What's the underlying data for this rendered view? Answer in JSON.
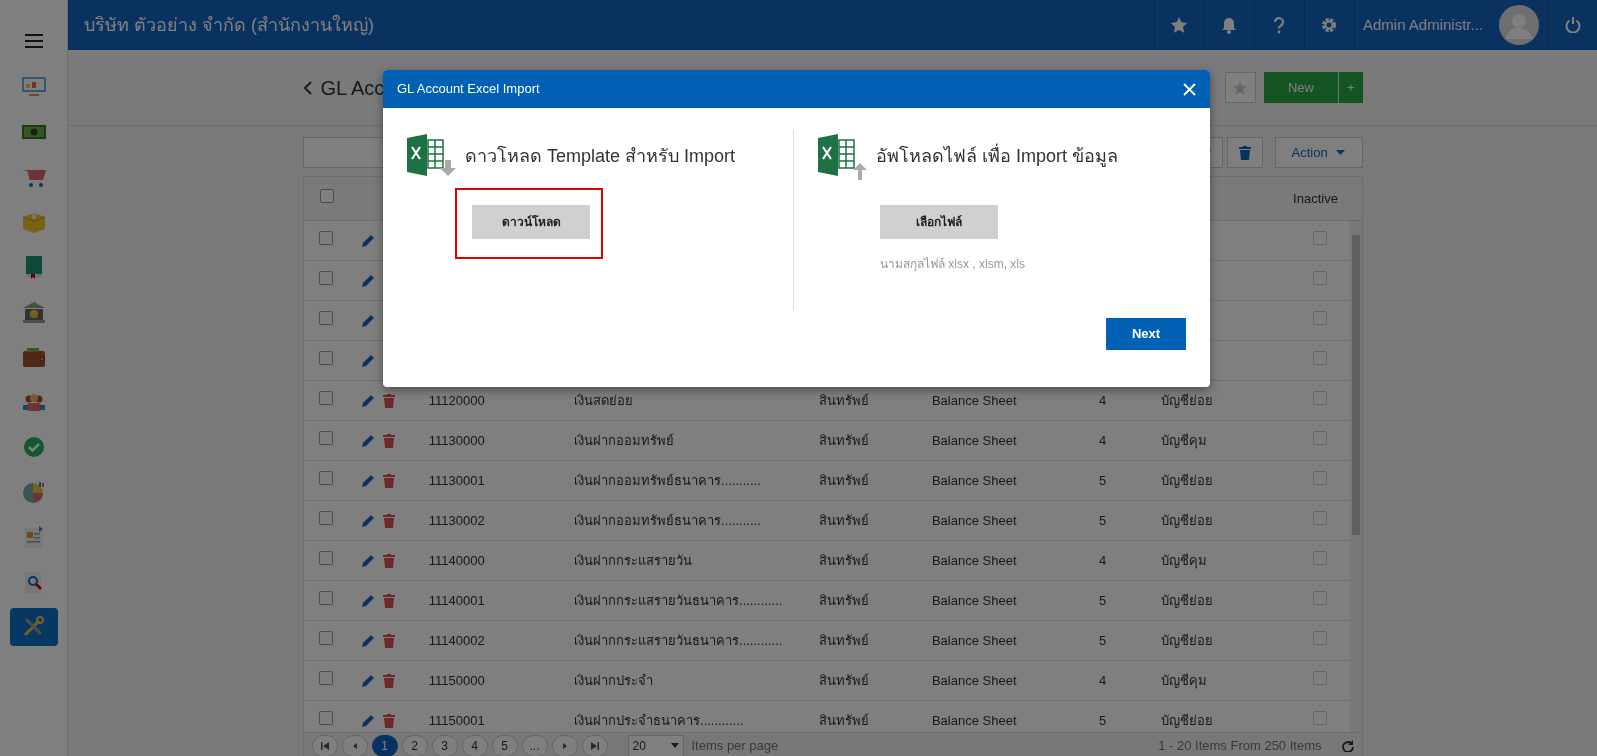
{
  "sidebar": {
    "items": [
      {
        "kind": "monitor",
        "selected": false
      },
      {
        "kind": "banknote",
        "selected": false
      },
      {
        "kind": "cart",
        "selected": false
      },
      {
        "kind": "box",
        "selected": false
      },
      {
        "kind": "book",
        "selected": false
      },
      {
        "kind": "bank",
        "selected": false
      },
      {
        "kind": "wallet",
        "selected": false
      },
      {
        "kind": "people",
        "selected": false
      },
      {
        "kind": "check",
        "selected": false
      },
      {
        "kind": "pie",
        "selected": false
      },
      {
        "kind": "invoice",
        "selected": false
      },
      {
        "kind": "search-doc",
        "selected": false
      },
      {
        "kind": "tools",
        "selected": true
      }
    ]
  },
  "topbar": {
    "company": "บริษัท ตัวอย่าง จำกัด (สำนักงานใหญ่)",
    "user": "Admin Administr..."
  },
  "page": {
    "title": "GL Acc",
    "new_button": "New",
    "new_plus": "+",
    "action_button": "Action"
  },
  "table": {
    "header_checked": false,
    "inactive_heading": "Inactive",
    "rows": [
      {
        "checked": false,
        "inactive": false
      },
      {
        "checked": false,
        "inactive": false
      },
      {
        "checked": false,
        "inactive": false
      },
      {
        "checked": false,
        "inactive": false
      },
      {
        "checked": false,
        "inactive": false,
        "code": "11120000",
        "name": "เงินสดย่อย",
        "type": "สินทรัพย์",
        "statement": "Balance Sheet",
        "level": "4",
        "account_kind": "บัญชีย่อย"
      },
      {
        "checked": false,
        "inactive": false,
        "code": "11130000",
        "name": "เงินฝากออมทรัพย์",
        "type": "สินทรัพย์",
        "statement": "Balance Sheet",
        "level": "4",
        "account_kind": "บัญชีคุม"
      },
      {
        "checked": false,
        "inactive": false,
        "code": "11130001",
        "name": "เงินฝากออมทรัพย์ธนาคาร...........",
        "type": "สินทรัพย์",
        "statement": "Balance Sheet",
        "level": "5",
        "account_kind": "บัญชีย่อย"
      },
      {
        "checked": false,
        "inactive": false,
        "code": "11130002",
        "name": "เงินฝากออมทรัพย์ธนาคาร...........",
        "type": "สินทรัพย์",
        "statement": "Balance Sheet",
        "level": "5",
        "account_kind": "บัญชีย่อย"
      },
      {
        "checked": false,
        "inactive": false,
        "code": "11140000",
        "name": "เงินฝากกระแสรายวัน",
        "type": "สินทรัพย์",
        "statement": "Balance Sheet",
        "level": "4",
        "account_kind": "บัญชีคุม"
      },
      {
        "checked": false,
        "inactive": false,
        "code": "11140001",
        "name": "เงินฝากกระแสรายวันธนาคาร............",
        "type": "สินทรัพย์",
        "statement": "Balance Sheet",
        "level": "5",
        "account_kind": "บัญชีย่อย"
      },
      {
        "checked": false,
        "inactive": false,
        "code": "11140002",
        "name": "เงินฝากกระแสรายวันธนาคาร............",
        "type": "สินทรัพย์",
        "statement": "Balance Sheet",
        "level": "5",
        "account_kind": "บัญชีย่อย"
      },
      {
        "checked": false,
        "inactive": false,
        "code": "11150000",
        "name": "เงินฝากประจำ",
        "type": "สินทรัพย์",
        "statement": "Balance Sheet",
        "level": "4",
        "account_kind": "บัญชีคุม"
      },
      {
        "checked": false,
        "inactive": false,
        "code": "11150001",
        "name": "เงินฝากประจำธนาคาร............",
        "type": "สินทรัพย์",
        "statement": "Balance Sheet",
        "level": "5",
        "account_kind": "บัญชีย่อย"
      }
    ]
  },
  "pagination": {
    "pages": [
      {
        "label": "1",
        "selected": true
      },
      {
        "label": "2",
        "selected": false
      },
      {
        "label": "3",
        "selected": false
      },
      {
        "label": "4",
        "selected": false
      },
      {
        "label": "5",
        "selected": false
      },
      {
        "label": "...",
        "selected": false
      }
    ],
    "page_size": "20",
    "page_size_label": "Items per page",
    "summary": "1 - 20 Items From 250 Items"
  },
  "modal": {
    "title": "GL Account Excel Import",
    "download": {
      "heading": "ดาวโหลด Template สำหรับ Import",
      "button": "ดาวน์โหลด",
      "highlighted": true
    },
    "upload": {
      "heading": "อัพโหลดไฟล์ เพื่อ Import ข้อมูล",
      "button": "เลือกไฟล์",
      "hint": "นามสกุลไฟล์ xlsx , xlsm, xls"
    },
    "next": "Next"
  }
}
